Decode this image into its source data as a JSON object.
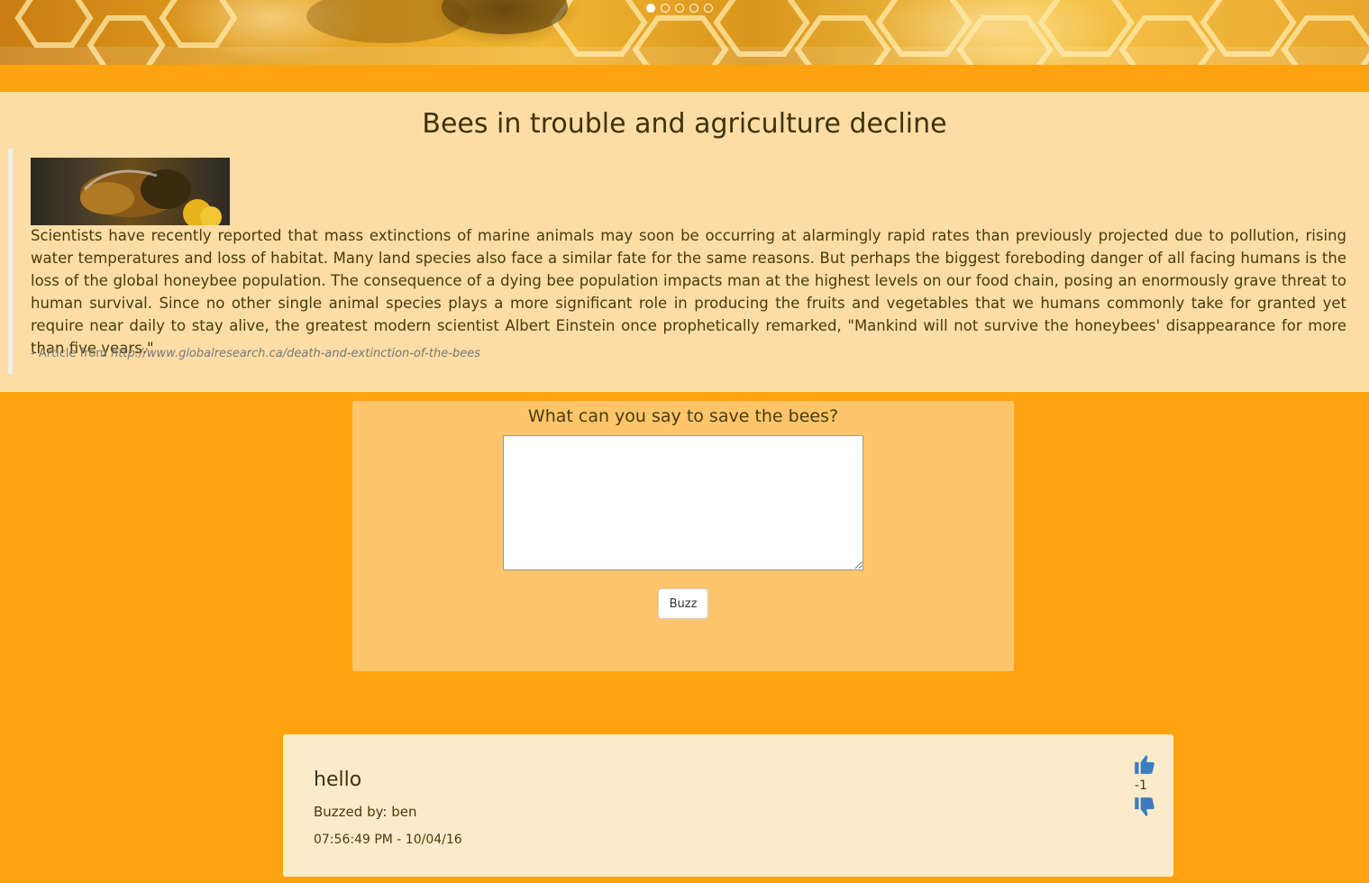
{
  "carousel": {
    "slide_count": 5,
    "active_index": 0
  },
  "article": {
    "title": "Bees in trouble and agriculture decline",
    "body": "Scientists have recently reported that mass extinctions of marine animals may soon be occurring at alarmingly rapid rates than previously projected due to pollution, rising water temperatures and loss of habitat. Many land species also face a similar fate for the same reasons. But perhaps the biggest foreboding danger of all facing humans is the loss of the global honeybee population. The consequence of a dying bee population impacts man at the highest levels on our food chain, posing an enormously grave threat to human survival. Since no other single animal species plays a more significant role in producing the fruits and vegetables that we humans commonly take for granted yet require near daily to stay alive, the greatest modern scientist Albert Einstein once prophetically remarked, \"Mankind will not survive the honeybees' disappearance for more than five years.\"",
    "source_prefix": "- Article from ",
    "source_link": "http://www.globalresearch.ca/death-and-extinction-of-the-bees"
  },
  "form": {
    "label": "What can you say to save the bees?",
    "input_value": "",
    "button_label": "Buzz"
  },
  "posts": [
    {
      "title": "hello",
      "author_line": "Buzzed by: ben",
      "timestamp": "07:56:49 PM - 10/04/16",
      "score": "-1",
      "upvote_icon": "thumbs-up-icon",
      "downvote_icon": "thumbs-down-icon"
    }
  ],
  "colors": {
    "page_bg": "#FFA20F",
    "article_bg": "#FCDDA6",
    "form_bg": "#FEC56A",
    "post_bg": "#FCEBCB",
    "vote_icon": "#3C7DC0"
  }
}
